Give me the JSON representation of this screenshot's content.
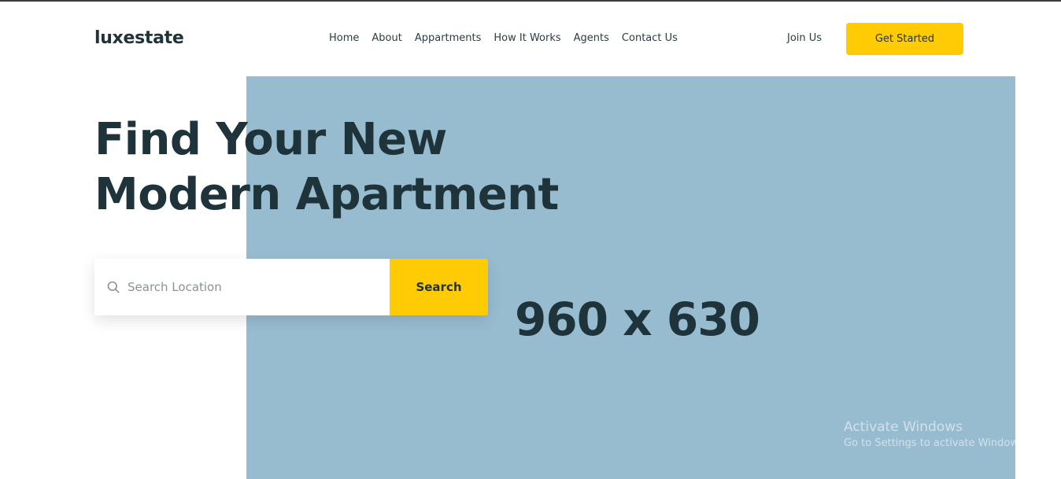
{
  "brand": {
    "name": "luxestate"
  },
  "nav": {
    "items": [
      "Home",
      "About",
      "Appartments",
      "How It Works",
      "Agents",
      "Contact Us"
    ]
  },
  "header": {
    "join_label": "Join Us",
    "cta_label": "Get Started"
  },
  "hero": {
    "headline_line1": "Find Your New",
    "headline_line2": "Modern Apartment",
    "image_placeholder_text": "960 x 630",
    "search": {
      "placeholder": "Search Location",
      "value": "",
      "button_label": "Search",
      "icon": "search-icon"
    }
  },
  "os_watermark": {
    "title": "Activate Windows",
    "subtitle": "Go to Settings to activate Windows."
  },
  "colors": {
    "accent": "#ffcb05",
    "text_dark": "#1f333a",
    "image_placeholder": "#98bccf",
    "background": "#ffffff"
  }
}
